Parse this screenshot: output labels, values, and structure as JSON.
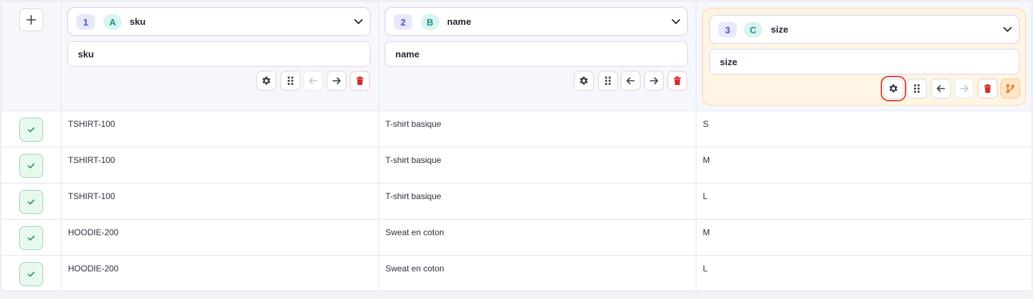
{
  "colors": {
    "accent": "#4b53c9",
    "letter_badge": "#18968a",
    "delete": "#d42a2a",
    "branch": "#e07a1f",
    "check": "#1f9d4f",
    "highlight": "#fff5e4",
    "selection_outline": "#e04848"
  },
  "columns": [
    {
      "index": "1",
      "letter": "A",
      "title": "sku",
      "name_value": "sku",
      "toolbar": [
        "gear-icon",
        "drag-handle-icon",
        "arrow-left-icon (disabled)",
        "arrow-right-icon",
        "trash-icon"
      ]
    },
    {
      "index": "2",
      "letter": "B",
      "title": "name",
      "name_value": "name",
      "toolbar": [
        "gear-icon",
        "drag-handle-icon",
        "arrow-left-icon",
        "arrow-right-icon",
        "trash-icon"
      ]
    },
    {
      "index": "3",
      "letter": "C",
      "title": "size",
      "name_value": "size",
      "highlighted": true,
      "toolbar": [
        "gear-icon (selected)",
        "drag-handle-icon",
        "arrow-left-icon",
        "arrow-right-icon (disabled)",
        "trash-icon",
        "git-branch-icon"
      ]
    }
  ],
  "add_column_icon": "plus-icon",
  "row_status_icon": "check-icon",
  "rows": [
    [
      "TSHIRT-100",
      "T-shirt basique",
      "S"
    ],
    [
      "TSHIRT-100",
      "T-shirt basique",
      "M"
    ],
    [
      "TSHIRT-100",
      "T-shirt basique",
      "L"
    ],
    [
      "HOODIE-200",
      "Sweat en coton",
      "M"
    ],
    [
      "HOODIE-200",
      "Sweat en coton",
      "L"
    ]
  ]
}
